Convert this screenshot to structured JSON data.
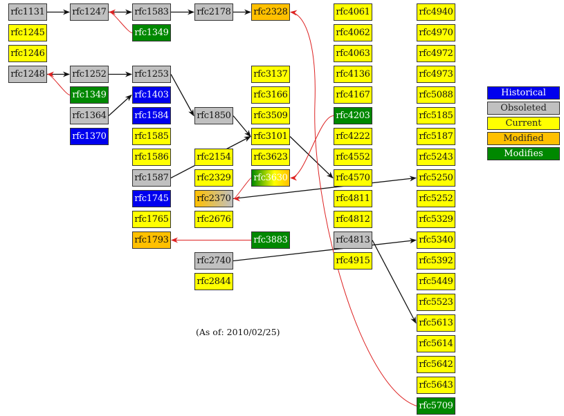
{
  "colors": {
    "Historical": "#0000ee",
    "Obsoleted": "#c0c0c0",
    "Current": "#ffff00",
    "Modified": "#ffc000",
    "Modifies": "#008800",
    "edge_normal": "#111111",
    "edge_modifies": "#dd2222"
  },
  "legend": [
    {
      "label": "Historical",
      "status": "Historical"
    },
    {
      "label": "Obsoleted",
      "status": "Obsoleted"
    },
    {
      "label": "Current",
      "status": "Current"
    },
    {
      "label": "Modified",
      "status": "Modified"
    },
    {
      "label": "Modifies",
      "status": "Modifies"
    }
  ],
  "note": "(As of: 2010/02/25)",
  "nodes": [
    {
      "id": "rfc1131",
      "label": "rfc1131",
      "status": "Obsoleted"
    },
    {
      "id": "rfc1245",
      "label": "rfc1245",
      "status": "Current"
    },
    {
      "id": "rfc1246",
      "label": "rfc1246",
      "status": "Current"
    },
    {
      "id": "rfc1248",
      "label": "rfc1248",
      "status": "Obsoleted"
    },
    {
      "id": "rfc1247",
      "label": "rfc1247",
      "status": "Obsoleted"
    },
    {
      "id": "rfc1252",
      "label": "rfc1252",
      "status": "Obsoleted"
    },
    {
      "id": "rfc1349a",
      "label": "rfc1349",
      "status": "Modifies"
    },
    {
      "id": "rfc1364",
      "label": "rfc1364",
      "status": "Obsoleted"
    },
    {
      "id": "rfc1370",
      "label": "rfc1370",
      "status": "Historical"
    },
    {
      "id": "rfc1583",
      "label": "rfc1583",
      "status": "Obsoleted"
    },
    {
      "id": "rfc1349b",
      "label": "rfc1349",
      "status": "Modifies"
    },
    {
      "id": "rfc1253",
      "label": "rfc1253",
      "status": "Obsoleted"
    },
    {
      "id": "rfc1403",
      "label": "rfc1403",
      "status": "Historical"
    },
    {
      "id": "rfc1584",
      "label": "rfc1584",
      "status": "Historical"
    },
    {
      "id": "rfc1585",
      "label": "rfc1585",
      "status": "Current"
    },
    {
      "id": "rfc1586",
      "label": "rfc1586",
      "status": "Current"
    },
    {
      "id": "rfc1587",
      "label": "rfc1587",
      "status": "Obsoleted"
    },
    {
      "id": "rfc1745",
      "label": "rfc1745",
      "status": "Historical"
    },
    {
      "id": "rfc1765",
      "label": "rfc1765",
      "status": "Current"
    },
    {
      "id": "rfc1793",
      "label": "rfc1793",
      "status": "Modified"
    },
    {
      "id": "rfc2178",
      "label": "rfc2178",
      "status": "Obsoleted"
    },
    {
      "id": "rfc1850",
      "label": "rfc1850",
      "status": "Obsoleted"
    },
    {
      "id": "rfc2154",
      "label": "rfc2154",
      "status": "Current"
    },
    {
      "id": "rfc2329",
      "label": "rfc2329",
      "status": "Current"
    },
    {
      "id": "rfc2370",
      "label": "rfc2370",
      "status": "Modified+Obsoleted"
    },
    {
      "id": "rfc2676",
      "label": "rfc2676",
      "status": "Current"
    },
    {
      "id": "rfc2740",
      "label": "rfc2740",
      "status": "Obsoleted"
    },
    {
      "id": "rfc2844",
      "label": "rfc2844",
      "status": "Current"
    },
    {
      "id": "rfc2328",
      "label": "rfc2328",
      "status": "Modified"
    },
    {
      "id": "rfc3137",
      "label": "rfc3137",
      "status": "Current"
    },
    {
      "id": "rfc3166",
      "label": "rfc3166",
      "status": "Current"
    },
    {
      "id": "rfc3509",
      "label": "rfc3509",
      "status": "Current"
    },
    {
      "id": "rfc3101",
      "label": "rfc3101",
      "status": "Current"
    },
    {
      "id": "rfc3623",
      "label": "rfc3623",
      "status": "Current"
    },
    {
      "id": "rfc3630",
      "label": "rfc3630",
      "status": "Modifies+Modified"
    },
    {
      "id": "rfc3883",
      "label": "rfc3883",
      "status": "Modifies"
    },
    {
      "id": "rfc4061",
      "label": "rfc4061",
      "status": "Current"
    },
    {
      "id": "rfc4062",
      "label": "rfc4062",
      "status": "Current"
    },
    {
      "id": "rfc4063",
      "label": "rfc4063",
      "status": "Current"
    },
    {
      "id": "rfc4136",
      "label": "rfc4136",
      "status": "Current"
    },
    {
      "id": "rfc4167",
      "label": "rfc4167",
      "status": "Current"
    },
    {
      "id": "rfc4203",
      "label": "rfc4203",
      "status": "Modifies"
    },
    {
      "id": "rfc4222",
      "label": "rfc4222",
      "status": "Current"
    },
    {
      "id": "rfc4552",
      "label": "rfc4552",
      "status": "Current"
    },
    {
      "id": "rfc4570",
      "label": "rfc4570",
      "status": "Current"
    },
    {
      "id": "rfc4811",
      "label": "rfc4811",
      "status": "Current"
    },
    {
      "id": "rfc4812",
      "label": "rfc4812",
      "status": "Current"
    },
    {
      "id": "rfc4813",
      "label": "rfc4813",
      "status": "Obsoleted"
    },
    {
      "id": "rfc4915",
      "label": "rfc4915",
      "status": "Current"
    },
    {
      "id": "rfc4940",
      "label": "rfc4940",
      "status": "Current"
    },
    {
      "id": "rfc4970",
      "label": "rfc4970",
      "status": "Current"
    },
    {
      "id": "rfc4972",
      "label": "rfc4972",
      "status": "Current"
    },
    {
      "id": "rfc4973",
      "label": "rfc4973",
      "status": "Current"
    },
    {
      "id": "rfc5088",
      "label": "rfc5088",
      "status": "Current"
    },
    {
      "id": "rfc5185",
      "label": "rfc5185",
      "status": "Current"
    },
    {
      "id": "rfc5187",
      "label": "rfc5187",
      "status": "Current"
    },
    {
      "id": "rfc5243",
      "label": "rfc5243",
      "status": "Current"
    },
    {
      "id": "rfc5250",
      "label": "rfc5250",
      "status": "Current"
    },
    {
      "id": "rfc5252",
      "label": "rfc5252",
      "status": "Current"
    },
    {
      "id": "rfc5329",
      "label": "rfc5329",
      "status": "Current"
    },
    {
      "id": "rfc5340",
      "label": "rfc5340",
      "status": "Current"
    },
    {
      "id": "rfc5392",
      "label": "rfc5392",
      "status": "Current"
    },
    {
      "id": "rfc5449",
      "label": "rfc5449",
      "status": "Current"
    },
    {
      "id": "rfc5523",
      "label": "rfc5523",
      "status": "Current"
    },
    {
      "id": "rfc5613",
      "label": "rfc5613",
      "status": "Current"
    },
    {
      "id": "rfc5614",
      "label": "rfc5614",
      "status": "Current"
    },
    {
      "id": "rfc5642",
      "label": "rfc5642",
      "status": "Current"
    },
    {
      "id": "rfc5643",
      "label": "rfc5643",
      "status": "Current"
    },
    {
      "id": "rfc5709",
      "label": "rfc5709",
      "status": "Modifies"
    }
  ],
  "edges": [
    {
      "from": "rfc1131",
      "to": "rfc1247",
      "type": "obsoletes"
    },
    {
      "from": "rfc1247",
      "to": "rfc1583",
      "type": "obsoletes"
    },
    {
      "from": "rfc1583",
      "to": "rfc2178",
      "type": "obsoletes"
    },
    {
      "from": "rfc2178",
      "to": "rfc2328",
      "type": "obsoletes"
    },
    {
      "from": "rfc1248",
      "to": "rfc1252",
      "type": "obsoletes"
    },
    {
      "from": "rfc1252",
      "to": "rfc1253",
      "type": "obsoletes"
    },
    {
      "from": "rfc1364",
      "to": "rfc1403",
      "type": "obsoletes"
    },
    {
      "from": "rfc1253",
      "to": "rfc1850",
      "type": "obsoletes"
    },
    {
      "from": "rfc1850",
      "to": "rfc3101",
      "type": "obsoletes"
    },
    {
      "from": "rfc1587",
      "to": "rfc3101",
      "type": "obsoletes"
    },
    {
      "from": "rfc3101",
      "to": "rfc4570",
      "type": "obsoletes"
    },
    {
      "from": "rfc2370",
      "to": "rfc5250",
      "type": "obsoletes"
    },
    {
      "from": "rfc2740",
      "to": "rfc5340",
      "type": "obsoletes"
    },
    {
      "from": "rfc4813",
      "to": "rfc5613",
      "type": "obsoletes"
    },
    {
      "from": "rfc1349b",
      "to": "rfc1247",
      "type": "modifies"
    },
    {
      "from": "rfc1349a",
      "to": "rfc1248",
      "type": "modifies"
    },
    {
      "from": "rfc4203",
      "to": "rfc3630",
      "type": "modifies"
    },
    {
      "from": "rfc3630",
      "to": "rfc2370",
      "type": "modifies"
    },
    {
      "from": "rfc3883",
      "to": "rfc1793",
      "type": "modifies"
    },
    {
      "from": "rfc5709",
      "to": "rfc2328",
      "type": "modifies"
    }
  ]
}
